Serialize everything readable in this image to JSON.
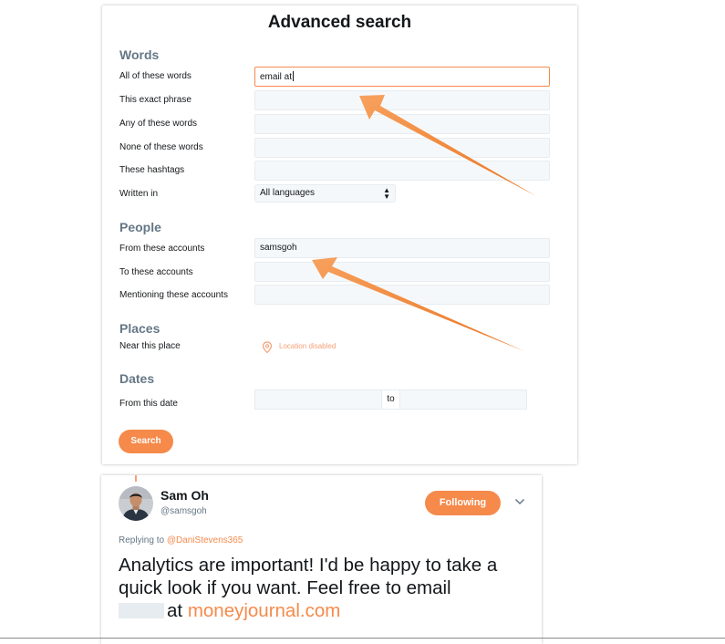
{
  "advanced_search": {
    "title": "Advanced search",
    "sections": {
      "words": "Words",
      "people": "People",
      "places": "Places",
      "dates": "Dates"
    },
    "fields": {
      "all_words": {
        "label": "All of these words",
        "value": "email at"
      },
      "exact_phrase": {
        "label": "This exact phrase",
        "value": ""
      },
      "any_words": {
        "label": "Any of these words",
        "value": ""
      },
      "none_words": {
        "label": "None of these words",
        "value": ""
      },
      "hashtags": {
        "label": "These hashtags",
        "value": ""
      },
      "written_in": {
        "label": "Written in",
        "value": "All languages"
      },
      "from_accounts": {
        "label": "From these accounts",
        "value": "samsgoh"
      },
      "to_accounts": {
        "label": "To these accounts",
        "value": ""
      },
      "mentioning": {
        "label": "Mentioning these accounts",
        "value": ""
      },
      "near_place": {
        "label": "Near this place",
        "value": "Location disabled"
      },
      "from_date": {
        "label": "From this date",
        "to": "to"
      }
    },
    "search_button": "Search"
  },
  "tweet": {
    "name": "Sam Oh",
    "handle": "@samsgoh",
    "follow_button": "Following",
    "replying_prefix": "Replying to",
    "replying_to": "@DaniStevens365",
    "text": "Analytics are important! I'd be happy to take a quick look if you want. Feel free to email",
    "text_after_redaction": "at",
    "link": "moneyjournal.com"
  },
  "icons": {
    "select_arrow": "select-arrows-icon",
    "location": "location-pin-icon",
    "chevron": "chevron-down-icon",
    "annotation_arrow": "orange-arrow-annotation"
  },
  "colors": {
    "accent": "#f58a4b",
    "secondary_text": "#657786",
    "field_bg": "#f5f8fa"
  }
}
